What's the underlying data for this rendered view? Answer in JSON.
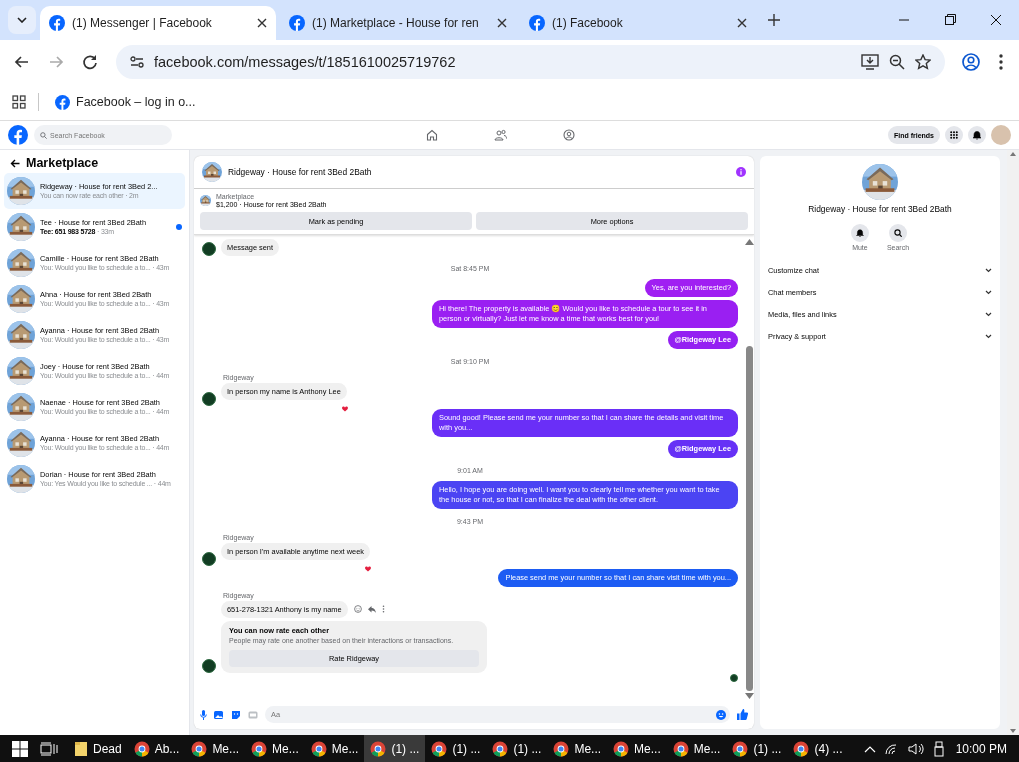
{
  "browser": {
    "tabs": [
      {
        "title": "(1) Messenger | Facebook",
        "selected": true
      },
      {
        "title": "(1) Marketplace - House for ren",
        "selected": false
      },
      {
        "title": "(1) Facebook",
        "selected": false
      }
    ],
    "url": "facebook.com/messages/t/1851610025719762",
    "bookmarks": [
      "Facebook – log in o..."
    ]
  },
  "facebook": {
    "search": {
      "placeholder": "Search Facebook"
    },
    "find_friends": "Find friends"
  },
  "sidebar": {
    "title": "Marketplace",
    "conversations": [
      {
        "name": "Ridgeway · House for rent 3Bed 2...",
        "preview": "You can now rate each other",
        "time": "· 2m",
        "selected": true,
        "unread": false
      },
      {
        "name": "Tee · House for rent 3Bed 2Bath",
        "preview": "Tee: 651 983 5728",
        "time": "· 33m",
        "selected": false,
        "unread": true
      },
      {
        "name": "Camille · House for rent 3Bed 2Bath",
        "preview": "You: Would you like to schedule a to...",
        "time": "· 43m",
        "selected": false,
        "unread": false
      },
      {
        "name": "Ahna · House for rent 3Bed 2Bath",
        "preview": "You: Would you like to schedule a to...",
        "time": "· 43m",
        "selected": false,
        "unread": false
      },
      {
        "name": "Ayanna · House for rent 3Bed 2Bath",
        "preview": "You: Would you like to schedule a to...",
        "time": "· 43m",
        "selected": false,
        "unread": false
      },
      {
        "name": "Joey · House for rent 3Bed 2Bath",
        "preview": "You: Would you like to schedule a to...",
        "time": "· 44m",
        "selected": false,
        "unread": false
      },
      {
        "name": "Naenae · House for rent 3Bed 2Bath",
        "preview": "You: Would you like to schedule a to...",
        "time": "· 44m",
        "selected": false,
        "unread": false
      },
      {
        "name": "Ayanna · House for rent 3Bed 2Bath",
        "preview": "You: Would you like to schedule a to...",
        "time": "· 44m",
        "selected": false,
        "unread": false
      },
      {
        "name": "Dorian · House for rent 3Bed 2Bath",
        "preview": "You: Yes Would you like to schedule ...",
        "time": "· 44m",
        "selected": false,
        "unread": false
      }
    ]
  },
  "chat": {
    "title": "Ridgeway · House for rent 3Bed 2Bath",
    "listing": {
      "label": "Marketplace",
      "summary": "$1,200 · House for rent 3Bed 2Bath"
    },
    "buttons": [
      "Mark as pending",
      "More options"
    ],
    "messages": [
      {
        "kind": "received",
        "text": "Message sent",
        "avatar": true,
        "reacted": false
      },
      {
        "kind": "time",
        "text": "Sat 8:45 PM"
      },
      {
        "kind": "sent",
        "text": "Yes, are you interested?",
        "color": "#a01ff2"
      },
      {
        "kind": "sent",
        "text": "Hi there! The property is available 😊 Would you like to schedule a tour to see it in person or virtually? Just let me know a time that works best for you!",
        "color": "#9a1ff2"
      },
      {
        "kind": "sent",
        "text": "@Ridgeway Lee",
        "color": "#9420f2",
        "bold": true
      },
      {
        "kind": "time",
        "text": "Sat 9:10 PM"
      },
      {
        "kind": "received",
        "sender": "Ridgeway",
        "text": "In person my name is Anthony Lee",
        "avatar": true,
        "reacted": true
      },
      {
        "kind": "sent",
        "text": "Sound good! Please send me your number so that I can share the details and visit time with you...",
        "color": "#6a2ff7"
      },
      {
        "kind": "sent",
        "text": "@Ridgeway Lee",
        "color": "#6631f6",
        "bold": true
      },
      {
        "kind": "time",
        "text": "9:01 AM"
      },
      {
        "kind": "sent",
        "text": "Hello, I hope you are doing well. I want you to clearly tell me whether you want to take the house or not, so that I can finalize the deal with the other client.",
        "color": "#4b44f3"
      },
      {
        "kind": "time",
        "text": "9:43 PM"
      },
      {
        "kind": "received",
        "sender": "Ridgeway",
        "text": "In person I'm available anytime next week",
        "avatar": true,
        "reacted": true
      },
      {
        "kind": "sent",
        "text": "Please send me your number so that I can share visit time with you...",
        "color": "#1d5cf3"
      },
      {
        "kind": "received",
        "sender": "Ridgeway",
        "text": "651-278-1321 Anthony is my name",
        "avatar": false,
        "reacted": false,
        "actions_shown": true
      },
      {
        "kind": "rating",
        "title": "You can now rate each other",
        "text": "People may rate one another based on their interactions or transactions.",
        "button": "Rate Ridgeway",
        "avatar": true
      }
    ],
    "composer": {
      "placeholder": "Aa"
    }
  },
  "details": {
    "title": "Ridgeway · House for rent 3Bed 2Bath",
    "actions": [
      {
        "kind": "mute",
        "label": "Mute"
      },
      {
        "kind": "search",
        "label": "Search"
      }
    ],
    "sections": [
      "Customize chat",
      "Chat members",
      "Media, files and links",
      "Privacy & support"
    ]
  },
  "taskbar": {
    "items": [
      {
        "kind": "folder",
        "label": "Dead",
        "selected": false
      },
      {
        "kind": "chrome",
        "label": "Ab...",
        "selected": false
      },
      {
        "kind": "chrome",
        "label": "Me...",
        "selected": false
      },
      {
        "kind": "chrome",
        "label": "Me...",
        "selected": false
      },
      {
        "kind": "chrome",
        "label": "Me...",
        "selected": false
      },
      {
        "kind": "chrome",
        "label": "(1) ...",
        "selected": true
      },
      {
        "kind": "chrome",
        "label": "(1) ...",
        "selected": false
      },
      {
        "kind": "chrome",
        "label": "(1) ...",
        "selected": false
      },
      {
        "kind": "chrome",
        "label": "Me...",
        "selected": false
      },
      {
        "kind": "chrome",
        "label": "Me...",
        "selected": false
      },
      {
        "kind": "chrome",
        "label": "Me...",
        "selected": false
      },
      {
        "kind": "chrome",
        "label": "(1) ...",
        "selected": false
      },
      {
        "kind": "chrome",
        "label": "(4) ...",
        "selected": false
      }
    ],
    "clock": "10:00 PM"
  }
}
